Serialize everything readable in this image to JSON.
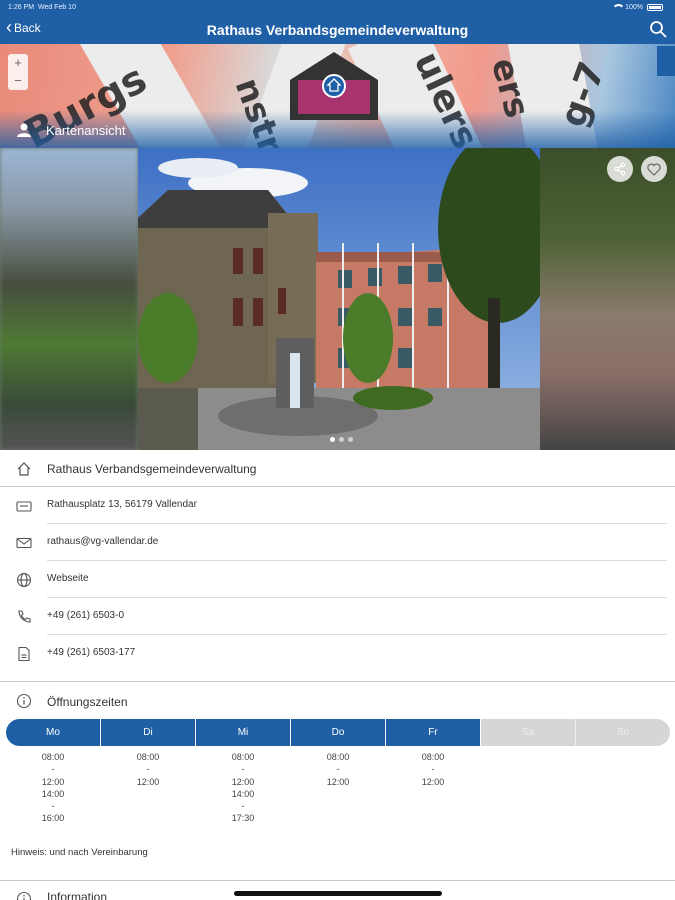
{
  "status": {
    "time": "1:26 PM",
    "date": "Wed Feb 10",
    "battery": "100%"
  },
  "nav": {
    "back_label": "Back",
    "title": "Rathaus Verbandsgemeindeverwaltung"
  },
  "map": {
    "zoom_in": "+",
    "zoom_out": "−",
    "map_view_label": "Kartenansicht",
    "street_fragments": [
      "Burgs",
      "nstr",
      "ulers",
      "ers",
      "g-7"
    ]
  },
  "gallery": {
    "active_index": 0,
    "count": 3
  },
  "details": {
    "name": "Rathaus Verbandsgemeindeverwaltung",
    "address": "Rathausplatz 13, 56179 Vallendar",
    "email": "rathaus@vg-vallendar.de",
    "website": "Webseite",
    "phone": "+49 (261) 6503-0",
    "fax": "+49 (261) 6503-177"
  },
  "opening_hours": {
    "title": "Öffnungszeiten",
    "days": [
      {
        "label": "Mo",
        "open": true,
        "times": [
          "08:00",
          "-",
          "12:00",
          "14:00",
          "-",
          "16:00"
        ]
      },
      {
        "label": "Di",
        "open": true,
        "times": [
          "08:00",
          "-",
          "12:00"
        ]
      },
      {
        "label": "Mi",
        "open": true,
        "times": [
          "08:00",
          "-",
          "12:00",
          "14:00",
          "-",
          "17:30"
        ]
      },
      {
        "label": "Do",
        "open": true,
        "times": [
          "08:00",
          "-",
          "12:00"
        ]
      },
      {
        "label": "Fr",
        "open": true,
        "times": [
          "08:00",
          "-",
          "12:00"
        ]
      },
      {
        "label": "Sa",
        "open": false,
        "times": []
      },
      {
        "label": "So",
        "open": false,
        "times": []
      }
    ],
    "note": "Hinweis: und nach Vereinbarung"
  },
  "information": {
    "title": "Information"
  },
  "colors": {
    "primary": "#1f5fa6",
    "closed_day": "#d6d6d6",
    "separator": "#dcdcdc"
  }
}
